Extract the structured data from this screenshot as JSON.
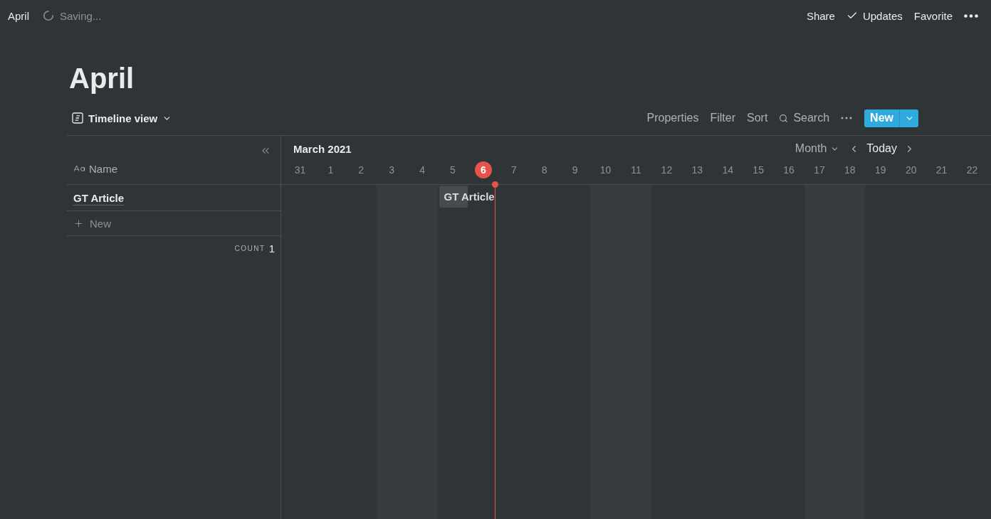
{
  "topbar": {
    "breadcrumb": "April",
    "status": "Saving...",
    "actions": [
      {
        "label": "Share",
        "kind": "text"
      },
      {
        "label": "Updates",
        "kind": "check"
      },
      {
        "label": "Favorite",
        "kind": "text"
      }
    ]
  },
  "page": {
    "title": "April"
  },
  "view_bar": {
    "view_name": "Timeline view",
    "actions": [
      "Properties",
      "Filter",
      "Sort"
    ],
    "search": "Search",
    "new_button": "New"
  },
  "table": {
    "column": "Name",
    "rows": [
      {
        "title": "GT Article"
      }
    ],
    "add_row": "New",
    "count_label": "COUNT",
    "count": "1"
  },
  "timeline": {
    "month": "March 2021",
    "zoom": "Month",
    "today_button": "Today",
    "days": [
      {
        "label": "31",
        "shaded": false,
        "today": false
      },
      {
        "label": "1",
        "shaded": false,
        "today": false
      },
      {
        "label": "2",
        "shaded": false,
        "today": false
      },
      {
        "label": "3",
        "shaded": true,
        "today": false
      },
      {
        "label": "4",
        "shaded": true,
        "today": false
      },
      {
        "label": "5",
        "shaded": false,
        "today": false,
        "items": [
          {
            "title": "GT Article"
          }
        ]
      },
      {
        "label": "6",
        "shaded": false,
        "today": true
      },
      {
        "label": "7",
        "shaded": false,
        "today": false
      },
      {
        "label": "8",
        "shaded": false,
        "today": false
      },
      {
        "label": "9",
        "shaded": false,
        "today": false
      },
      {
        "label": "10",
        "shaded": true,
        "today": false
      },
      {
        "label": "11",
        "shaded": true,
        "today": false
      },
      {
        "label": "12",
        "shaded": false,
        "today": false
      },
      {
        "label": "13",
        "shaded": false,
        "today": false
      },
      {
        "label": "14",
        "shaded": false,
        "today": false
      },
      {
        "label": "15",
        "shaded": false,
        "today": false
      },
      {
        "label": "16",
        "shaded": false,
        "today": false
      },
      {
        "label": "17",
        "shaded": true,
        "today": false
      },
      {
        "label": "18",
        "shaded": true,
        "today": false
      },
      {
        "label": "19",
        "shaded": false,
        "today": false
      },
      {
        "label": "20",
        "shaded": false,
        "today": false
      },
      {
        "label": "21",
        "shaded": false,
        "today": false
      },
      {
        "label": "22",
        "shaded": false,
        "today": false
      }
    ]
  }
}
